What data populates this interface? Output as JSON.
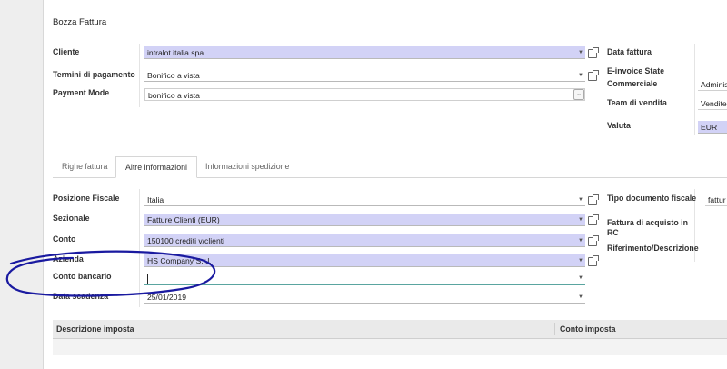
{
  "title": "Bozza Fattura",
  "header_left": {
    "cliente": {
      "label": "Cliente",
      "value": "intralot italia spa"
    },
    "termini": {
      "label": "Termini di pagamento",
      "value": "Bonifico a vista"
    },
    "payment_mode": {
      "label": "Payment Mode",
      "value": "bonifico a vista"
    }
  },
  "header_right": {
    "data_fattura": {
      "label": "Data fattura",
      "value": ""
    },
    "einvoice": {
      "label_line1": "E-invoice State",
      "label_line2": "Commerciale",
      "value": "Adminis"
    },
    "team": {
      "label": "Team di vendita",
      "value": "Vendite"
    },
    "valuta": {
      "label": "Valuta",
      "value": "EUR"
    }
  },
  "tabs": [
    {
      "label": "Righe fattura",
      "active": false
    },
    {
      "label": "Altre informazioni",
      "active": true
    },
    {
      "label": "Informazioni spedizione",
      "active": false
    }
  ],
  "other_left": {
    "posizione": {
      "label": "Posizione Fiscale",
      "value": "Italia"
    },
    "sezionale": {
      "label": "Sezionale",
      "value": "Fatture Clienti (EUR)"
    },
    "conto": {
      "label": "Conto",
      "value": "150100 crediti v/clienti"
    },
    "azienda": {
      "label": "Azienda",
      "value": "HS Company S.r.l."
    },
    "conto_bancario": {
      "label": "Conto bancario",
      "value": ""
    },
    "data_scadenza": {
      "label": "Data scadenza",
      "value": "25/01/2019"
    }
  },
  "other_right": {
    "tipo_documento": {
      "label": "Tipo documento fiscale",
      "value": "fattur"
    },
    "fattura_rc": {
      "label_line1": "Fattura di acquisto in",
      "label_line2": "RC"
    },
    "riferimento": {
      "label": "Riferimento/Descrizione"
    }
  },
  "tax_table": {
    "columns": [
      "Descrizione imposta",
      "Conto imposta"
    ]
  },
  "colors": {
    "required_field": "#d2d2f6",
    "annotation": "#1a1aa0",
    "focus_underline": "#5aa5a0"
  },
  "icons": [
    "external-link-icon",
    "dropdown-caret-icon",
    "select-arrow-icon"
  ]
}
